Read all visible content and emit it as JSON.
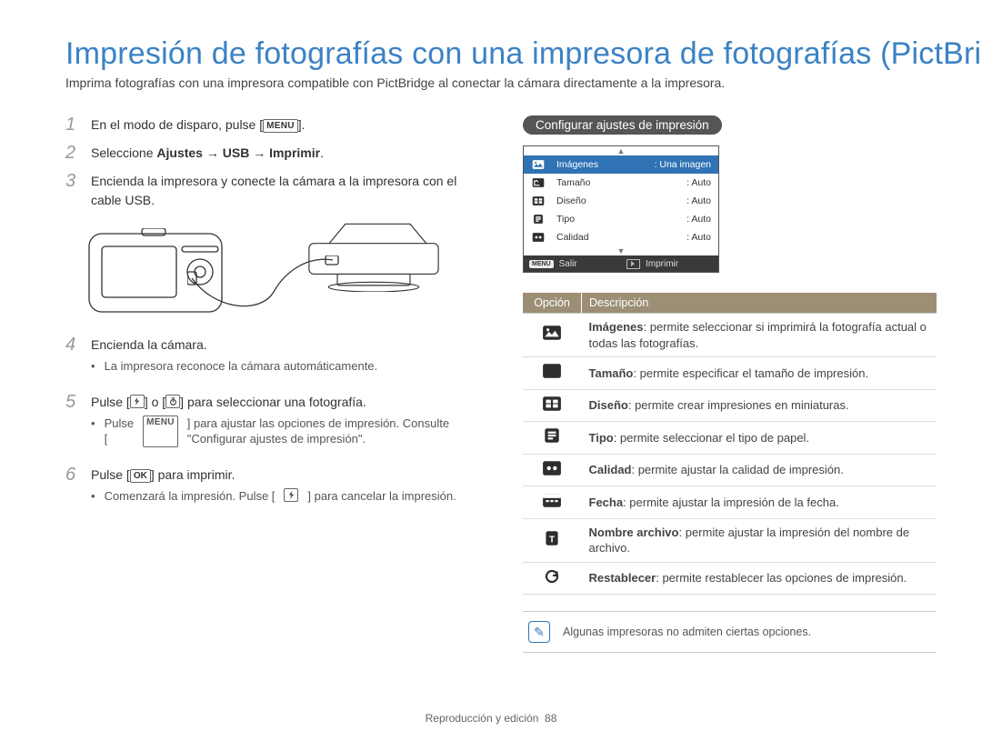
{
  "header": {
    "title": "Impresión de fotografías con una impresora de fotografías (PictBri",
    "intro": "Imprima fotografías con una impresora compatible con PictBridge al conectar la cámara directamente a la impresora."
  },
  "steps_labels": {
    "step1_pre": "En el modo de disparo, pulse [",
    "step1_post": "].",
    "step2_pre": "Seleccione ",
    "step2_bold": "Ajustes → USB → Imprimir",
    "step2_post": ".",
    "step3": "Encienda la impresora y conecte la cámara a la impresora con el cable USB.",
    "step4": "Encienda la cámara.",
    "step4_bullet": "La impresora reconoce la cámara automáticamente.",
    "step5_pre": "Pulse [",
    "step5_mid": "] o [",
    "step5_post": "] para seleccionar una fotografía.",
    "step5_bullet_pre": "Pulse [",
    "step5_bullet_post": "] para ajustar las opciones de impresión. Consulte \"Configurar ajustes de impresión\".",
    "step6_pre": "Pulse [",
    "step6_post": "] para imprimir.",
    "step6_bullet_pre": "Comenzará la impresión. Pulse [",
    "step6_bullet_post": "] para cancelar la impresión."
  },
  "icons": {
    "menu": "MENU",
    "ok": "OK"
  },
  "pill": "Configurar ajustes de impresión",
  "screen": {
    "rows": [
      {
        "label": "Imágenes",
        "value": "Una imagen",
        "sel": true
      },
      {
        "label": "Tamaño",
        "value": "Auto"
      },
      {
        "label": "Diseño",
        "value": "Auto"
      },
      {
        "label": "Tipo",
        "value": "Auto"
      },
      {
        "label": "Calidad",
        "value": "Auto"
      }
    ],
    "footer_left": "Salir",
    "footer_right": "Imprimir"
  },
  "desc_table": {
    "head_opt": "Opción",
    "head_desc": "Descripción",
    "rows": [
      {
        "title": "Imágenes",
        "desc": ": permite seleccionar si imprimirá la fotografía actual o todas las fotografías."
      },
      {
        "title": "Tamaño",
        "desc": ": permite especificar el tamaño de impresión."
      },
      {
        "title": "Diseño",
        "desc": ": permite crear impresiones en miniaturas."
      },
      {
        "title": "Tipo",
        "desc": ": permite seleccionar el tipo de papel."
      },
      {
        "title": "Calidad",
        "desc": ": permite ajustar la calidad de impresión."
      },
      {
        "title": "Fecha",
        "desc": ": permite ajustar la impresión de la fecha."
      },
      {
        "title": "Nombre archivo",
        "desc": ": permite ajustar la impresión del nombre de archivo."
      },
      {
        "title": "Restablecer",
        "desc": ": permite restablecer las opciones de impresión."
      }
    ]
  },
  "note_text": "Algunas impresoras no admiten ciertas opciones.",
  "footer": {
    "section": "Reproducción y edición",
    "page": "88"
  }
}
